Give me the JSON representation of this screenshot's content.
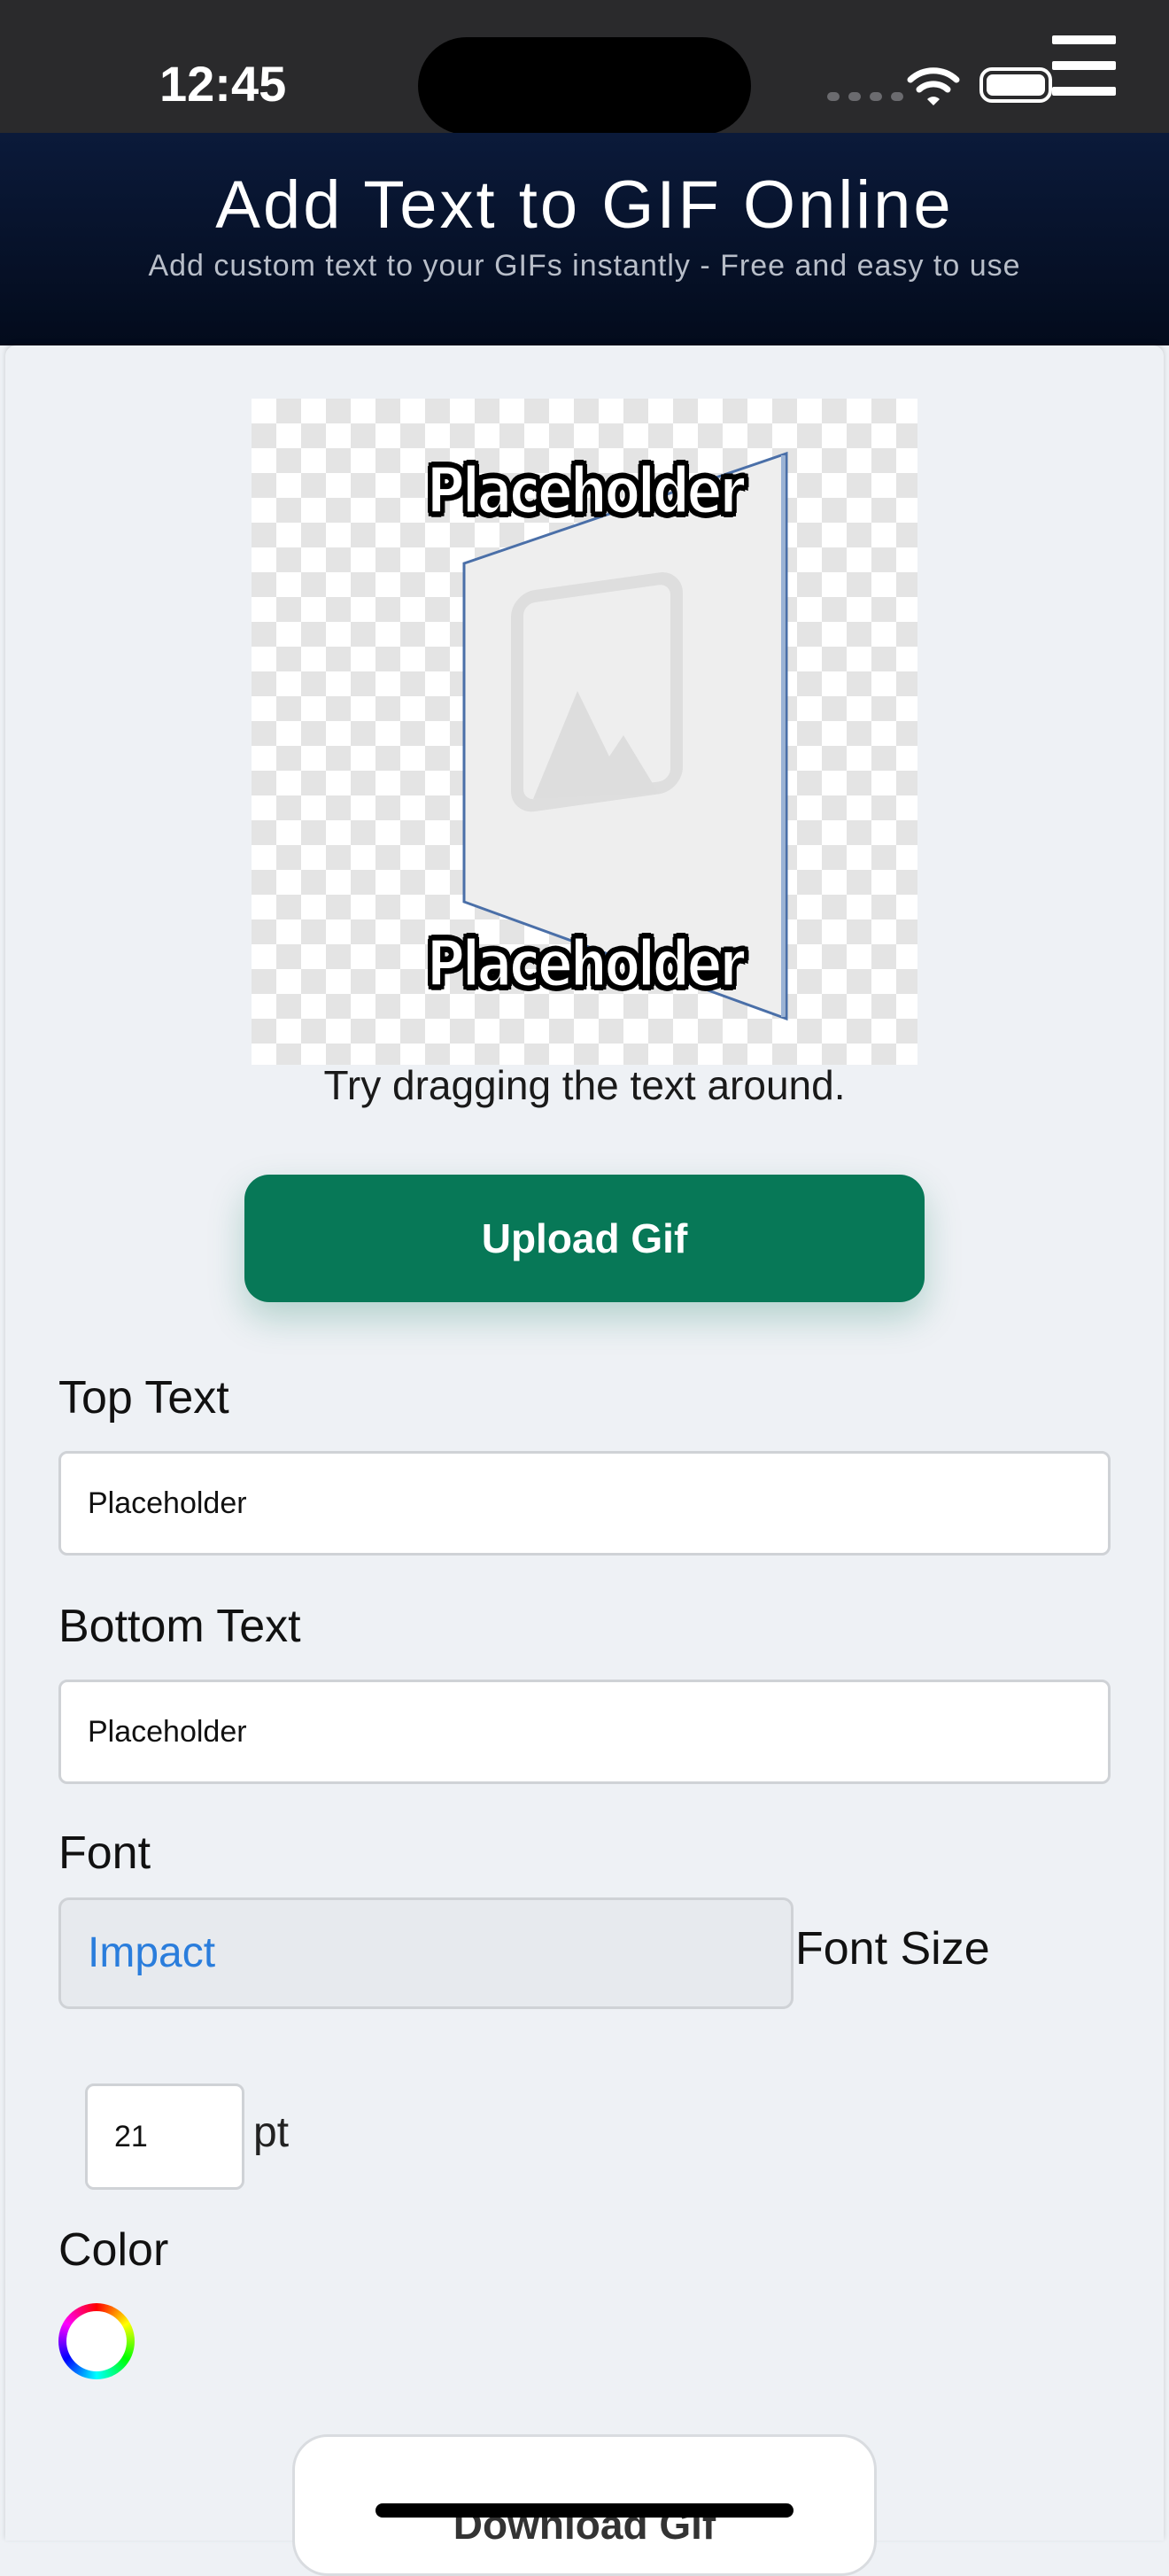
{
  "status_bar": {
    "time": "12:45"
  },
  "header": {
    "title": "Add Text to GIF Online",
    "subtitle": "Add custom text to your GIFs instantly - Free and easy to use"
  },
  "preview": {
    "top_text": "Placeholder",
    "bottom_text": "Placeholder",
    "hint": "Try dragging the text around."
  },
  "upload_button": {
    "label": "Upload Gif",
    "color": "#077857"
  },
  "form": {
    "top_text_label": "Top Text",
    "top_text_value": "Placeholder",
    "bottom_text_label": "Bottom Text",
    "bottom_text_value": "Placeholder",
    "font_label": "Font",
    "font_value": "Impact",
    "font_size_label": "Font Size",
    "font_size_value": "21",
    "font_size_unit": "pt",
    "color_label": "Color"
  },
  "download_button": {
    "label": "Download Gif"
  },
  "icons": {
    "menu": "hamburger-menu-icon",
    "wifi": "wifi-icon",
    "battery": "battery-icon",
    "color_picker": "color-wheel-icon",
    "placeholder_image": "image-placeholder-icon"
  }
}
